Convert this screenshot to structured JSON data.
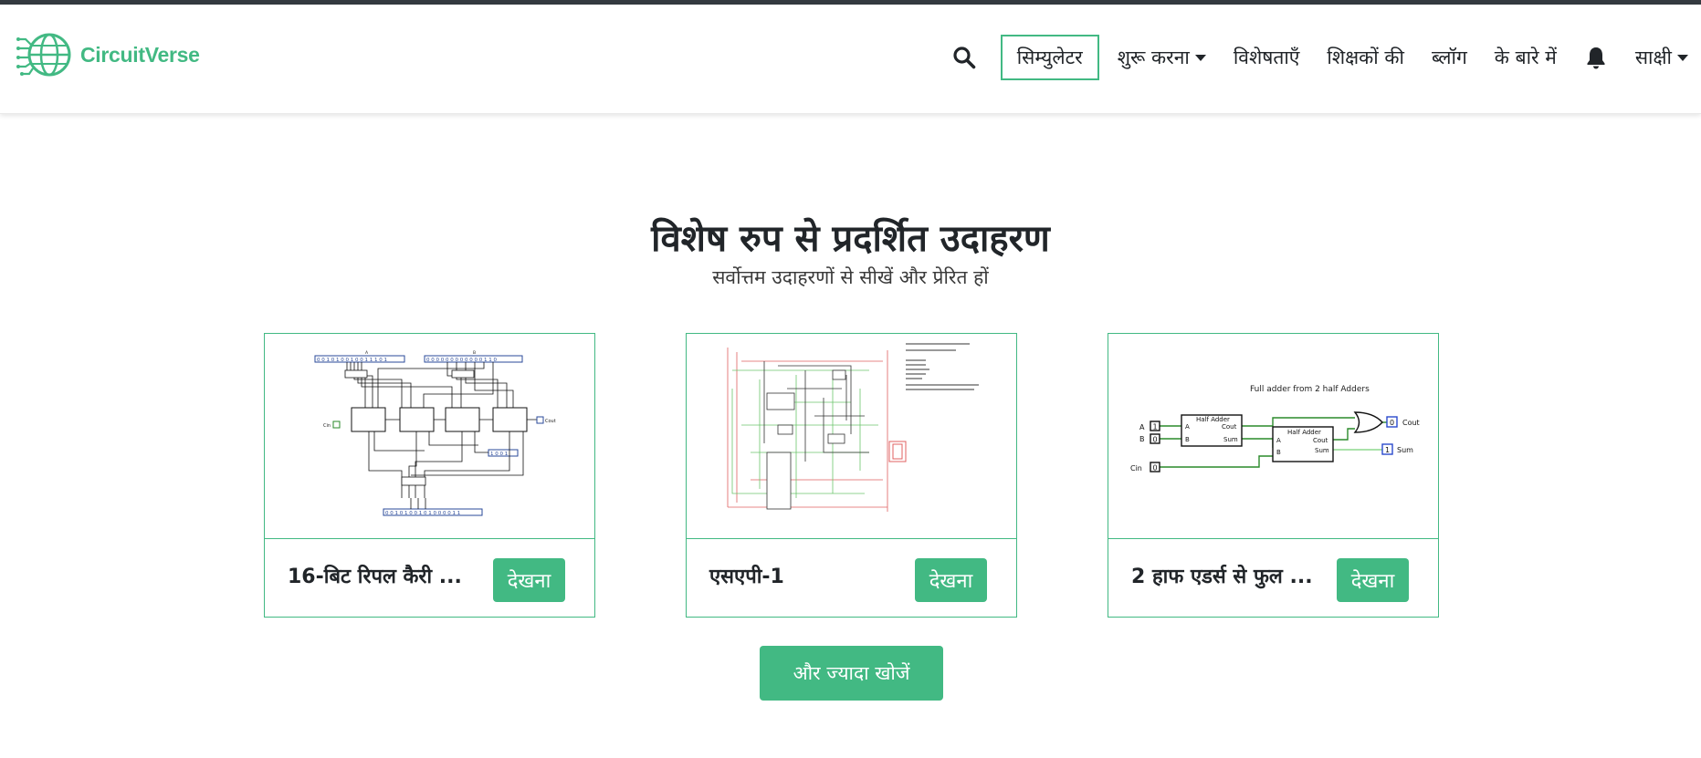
{
  "brand": {
    "name": "CircuitVerse",
    "color": "#42b983"
  },
  "nav": {
    "search_icon": "search-icon",
    "simulator_label": "सिम्युलेटर",
    "getting_started_label": "शुरू करना",
    "features_label": "विशेषताएँ",
    "teachers_label": "शिक्षकों की",
    "blog_label": "ब्लॉग",
    "about_label": "के बारे में",
    "bell_icon": "bell-icon",
    "user_label": "साक्षी"
  },
  "featured": {
    "title": "विशेष रुप से प्रदर्शित उदाहरण",
    "subtitle": "सर्वोत्तम उदाहरणों से सीखें और प्रेरित हों",
    "cards": [
      {
        "title": "16-बिट रिपल कैरी ...",
        "button": "देखना",
        "thumb": {
          "top_bits_a": "0 0 1 0 1 0 0 1 0 0 1 1 1 0 1",
          "top_bits_b": "0 0 0 0 0 0 0 0 0 0 0 0 1 1 0",
          "bottom_bits": "0 0 1 0 1 0 0 1 0 1 0 0 0 0 1 1",
          "mid_bits": "1 0 0 1",
          "cin_label": "Cin",
          "cout_label": "Cout",
          "label_a": "A",
          "label_b": "B"
        }
      },
      {
        "title": "एसएपी-1",
        "button": "देखना"
      },
      {
        "title": "2 हाफ एडर्स से फुल ...",
        "button": "देखना",
        "thumb": {
          "heading": "Full adder from 2 half Adders",
          "half_adder": "Half Adder",
          "label_a": "A",
          "label_b": "B",
          "label_cin": "Cin",
          "val_a": "1",
          "val_b": "0",
          "val_cin": "0",
          "port_a": "A",
          "port_b": "B",
          "port_cout": "Cout",
          "port_sum": "Sum",
          "out_cout_val": "0",
          "out_cout": "Cout",
          "out_sum_val": "1",
          "out_sum": "Sum"
        }
      }
    ],
    "more_button": "और ज्यादा खोजें"
  }
}
